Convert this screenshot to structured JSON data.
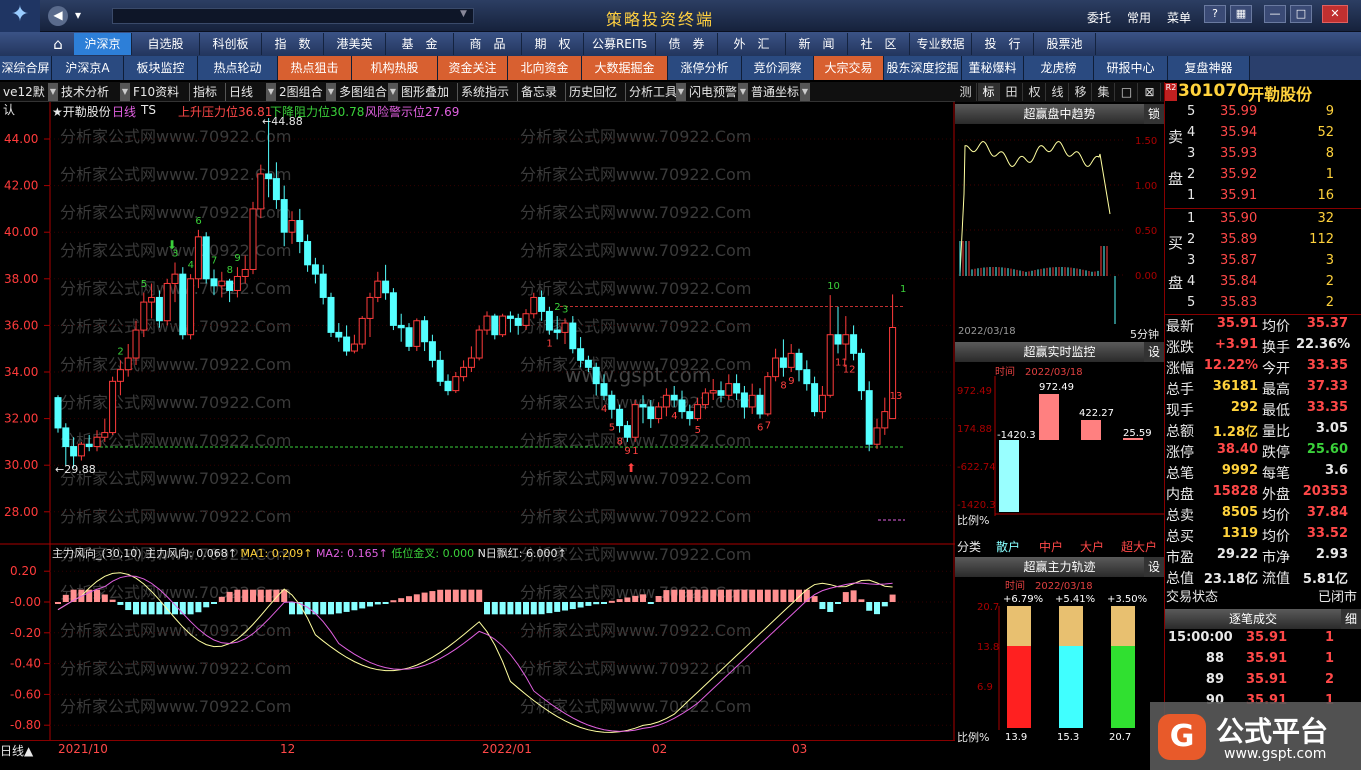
{
  "window": {
    "title": "策略投资终端",
    "top_menu": [
      "委托",
      "常用",
      "菜单"
    ],
    "window_buttons": [
      "?",
      "—",
      "□",
      "✕"
    ]
  },
  "nav_row1": [
    "沪深京",
    "自选股",
    "科创板",
    "指　数",
    "港美英",
    "基　金",
    "商　品",
    "期　权",
    "公募REITs",
    "债　券",
    "外　汇",
    "新　闻",
    "社　区",
    "专业数据",
    "投　行",
    "股票池"
  ],
  "nav_row2": [
    "深综合屏",
    "沪深京A",
    "板块监控",
    "热点轮动",
    "热点狙击",
    "机构热股",
    "资金关注",
    "北向资金",
    "大数据掘金",
    "涨停分析",
    "竞价洞察",
    "大宗交易",
    "股东深度挖掘",
    "董秘爆料",
    "龙虎榜",
    "研报中心",
    "复盘神器"
  ],
  "toolbar": [
    "ve12默认",
    "技术分析",
    "F10资料",
    "指标",
    "日线",
    "2图组合",
    "多图组合",
    "图形叠加",
    "系统指示",
    "备忘录",
    "历史回忆",
    "分析工具",
    "闪电预警",
    "普通坐标"
  ],
  "main_chart": {
    "stock_label": "★开勒股份",
    "period": "日线",
    "ts": "TS",
    "upper_pressure": "上升压力位36.81",
    "lower_resistance": "下降阻力位30.78",
    "risk_warning": "风险警示位27.69",
    "max_label": "44.88",
    "min_label": "29.88",
    "y_ticks": [
      "44.00",
      "42.00",
      "40.00",
      "38.00",
      "36.00",
      "34.00",
      "32.00",
      "30.00",
      "28.00"
    ],
    "counts": [
      "1",
      "2",
      "3",
      "4",
      "5",
      "6",
      "7",
      "8",
      "9"
    ]
  },
  "indicator": {
    "name": "主力风向_(30,10)",
    "value_text": "主力风向: 0.068↑",
    "ma1_text": "MA1: 0.209↑",
    "ma2_text": "MA2: 0.165↑",
    "gold_cross_text": "低位金叉: 0.000",
    "n_day_text": "N日飘红: 6.000↑",
    "y_ticks": [
      "0.20",
      "-0.00",
      "-0.20",
      "-0.40",
      "-0.60",
      "-0.80"
    ]
  },
  "x_axis": {
    "period_label": "日线▲",
    "dates": [
      "2021/10",
      "12",
      "2022/01",
      "02",
      "03"
    ]
  },
  "watermarks": [
    "分析家公式网www.70922.Com",
    "www.gspt.com"
  ],
  "mid_tabs": [
    "测",
    "标",
    "田",
    "权",
    "线",
    "移",
    "集",
    "□",
    "⊠"
  ],
  "intraday": {
    "title": "超赢盘中趋势",
    "lock": "锁",
    "y_right": [
      "1.50",
      "1.00",
      "0.50",
      "0.00"
    ],
    "date": "2022/03/18",
    "period": "5分钟"
  },
  "monitor": {
    "title": "超赢实时监控",
    "btn": "设",
    "time_label": "时间",
    "time_value": "2022/03/18",
    "y_left": [
      "972.49",
      "174.88",
      "-622.74",
      "-1420.3"
    ],
    "bar_values": [
      "-1420.3",
      "972.49",
      "422.27",
      "25.59"
    ],
    "ratio_label": "比例%",
    "categories": [
      "分类",
      "散户",
      "中户",
      "大户",
      "超大户"
    ]
  },
  "track": {
    "title": "超赢主力轨迹",
    "btn": "设",
    "time_label": "时间",
    "time_value": "2022/03/18",
    "pct": [
      "+6.79%",
      "+5.41%",
      "+3.50%"
    ],
    "y_left": [
      "20.7",
      "13.8",
      "6.9"
    ],
    "bottom_vals": [
      "13.9",
      "15.3",
      "20.7"
    ],
    "ratio_label": "比例%"
  },
  "quote": {
    "code": "301070",
    "name": "开勒股份",
    "badge": "R2",
    "sell_side": "卖",
    "sell_pan": "盘",
    "buy_side": "买",
    "buy_pan": "盘",
    "asks": [
      {
        "n": "5",
        "price": "35.99",
        "vol": "9"
      },
      {
        "n": "4",
        "price": "35.94",
        "vol": "52"
      },
      {
        "n": "3",
        "price": "35.93",
        "vol": "8"
      },
      {
        "n": "2",
        "price": "35.92",
        "vol": "1"
      },
      {
        "n": "1",
        "price": "35.91",
        "vol": "16"
      }
    ],
    "bids": [
      {
        "n": "1",
        "price": "35.90",
        "vol": "32"
      },
      {
        "n": "2",
        "price": "35.89",
        "vol": "112"
      },
      {
        "n": "3",
        "price": "35.87",
        "vol": "3"
      },
      {
        "n": "4",
        "price": "35.84",
        "vol": "2"
      },
      {
        "n": "5",
        "price": "35.83",
        "vol": "2"
      }
    ],
    "stats": [
      {
        "l1": "最新",
        "v1": "35.91",
        "l2": "均价",
        "v2": "35.37"
      },
      {
        "l1": "涨跌",
        "v1": "+3.91",
        "l2": "换手",
        "v2": "22.36%"
      },
      {
        "l1": "涨幅",
        "v1": "12.22%",
        "l2": "今开",
        "v2": "33.35"
      },
      {
        "l1": "总手",
        "v1": "36181",
        "l2": "最高",
        "v2": "37.33"
      },
      {
        "l1": "现手",
        "v1": "292",
        "l2": "最低",
        "v2": "33.35"
      },
      {
        "l1": "总额",
        "v1": "1.28亿",
        "l2": "量比",
        "v2": "3.05"
      },
      {
        "l1": "涨停",
        "v1": "38.40",
        "l2": "跌停",
        "v2": "25.60"
      },
      {
        "l1": "总笔",
        "v1": "9992",
        "l2": "每笔",
        "v2": "3.6"
      },
      {
        "l1": "内盘",
        "v1": "15828",
        "l2": "外盘",
        "v2": "20353"
      },
      {
        "l1": "总卖",
        "v1": "8505",
        "l2": "均价",
        "v2": "37.84"
      },
      {
        "l1": "总买",
        "v1": "1319",
        "l2": "均价",
        "v2": "33.52"
      },
      {
        "l1": "市盈",
        "v1": "29.22",
        "l2": "市净",
        "v2": "2.93"
      },
      {
        "l1": "总值",
        "v1": "23.18亿",
        "l2": "流值",
        "v2": "5.81亿"
      }
    ],
    "trade_status_label": "交易状态",
    "trade_status": "已闭市",
    "ticks_title": "逐笔成交",
    "ticks_btn": "细",
    "ticks": [
      {
        "t": "15:00:00",
        "p": "35.91",
        "v": "1"
      },
      {
        "t": "88",
        "p": "35.91",
        "v": "1"
      },
      {
        "t": "89",
        "p": "35.91",
        "v": "2"
      },
      {
        "t": "90",
        "p": "35.91",
        "v": "1"
      }
    ]
  },
  "brand": {
    "name": "公式平台",
    "url": "www.gspt.com"
  }
}
